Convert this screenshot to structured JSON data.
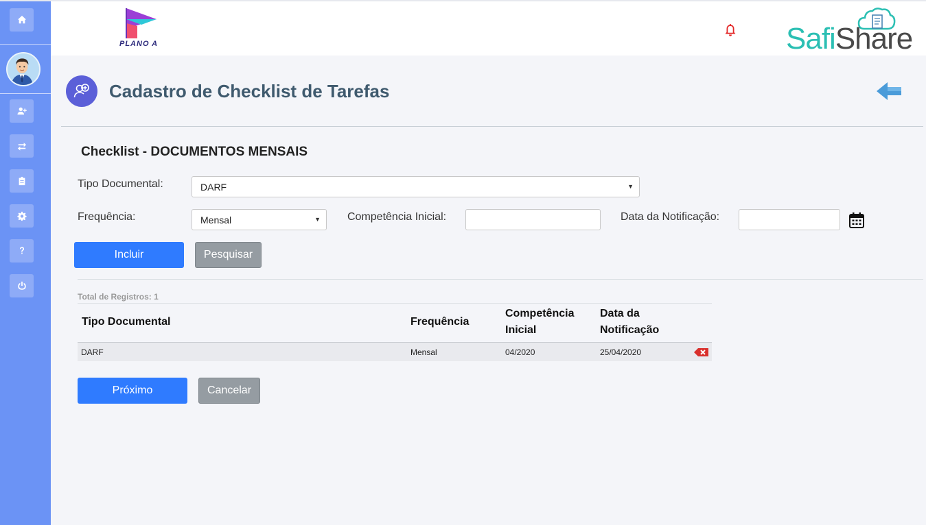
{
  "sidebar": {
    "items": [
      {
        "icon": "home-icon"
      },
      {
        "icon": "add-user-icon"
      },
      {
        "icon": "exchange-icon"
      },
      {
        "icon": "clipboard-icon"
      },
      {
        "icon": "gear-icon"
      },
      {
        "icon": "question-icon"
      },
      {
        "icon": "power-icon"
      }
    ]
  },
  "header": {
    "logo_text": "PLANO A",
    "brand_part1": "Safi",
    "brand_part2": "Share"
  },
  "page": {
    "title": "Cadastro de Checklist de Tarefas",
    "subtitle": "Checklist - DOCUMENTOS MENSAIS"
  },
  "form": {
    "tipo_label": "Tipo Documental:",
    "tipo_value": "DARF",
    "freq_label": "Frequência:",
    "freq_value": "Mensal",
    "comp_label": "Competência Inicial:",
    "comp_value": "",
    "notif_label": "Data da Notificação:",
    "notif_value": "",
    "incluir_label": "Incluir",
    "pesquisar_label": "Pesquisar"
  },
  "table": {
    "total_label": "Total de Registros:",
    "total_value": "1",
    "headers": {
      "tipo": "Tipo Documental",
      "freq": "Frequência",
      "comp_1": "Competência",
      "comp_2": "Inicial",
      "notif_1": "Data da",
      "notif_2": "Notificação"
    },
    "rows": [
      {
        "tipo": "DARF",
        "freq": "Mensal",
        "comp": "04/2020",
        "notif": "25/04/2020"
      }
    ]
  },
  "footer": {
    "proximo_label": "Próximo",
    "cancelar_label": "Cancelar"
  },
  "colors": {
    "sidebar": "#6b93f5",
    "primary": "#2f7bff",
    "title": "#3f5a6e",
    "brand_teal": "#2bbfb3",
    "danger": "#d9302c"
  }
}
